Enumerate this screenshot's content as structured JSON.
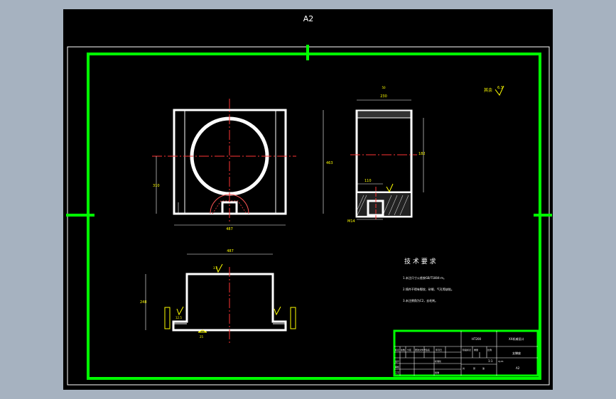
{
  "sheet": {
    "size_label": "A2",
    "roughness_note": "其余",
    "roughness_value": "6.3"
  },
  "dims": {
    "front_width": "487",
    "front_height": "463",
    "front_left": "310",
    "side_width": "230",
    "side_height": "182",
    "side_small": "110",
    "side_top": "50",
    "side_bottom": "M14",
    "plan_width": "487",
    "plan_height": "248",
    "rough_a": "12.5",
    "rough_b": "3.2",
    "rough_c": "25"
  },
  "tech": {
    "title": "技 术 要 求",
    "items": [
      "1.未注尺寸公差按GB/T1804-m。",
      "2.铸件不得有裂纹、砂眼、气孔等缺陷。",
      "3.未注倒角为C2，去毛刺。"
    ]
  },
  "title_block": {
    "part_name": "支撑座",
    "org": "XX机械设计",
    "drawing_no": "XJ-01",
    "material": "HT200",
    "scale": "1:1",
    "sheet": "A2",
    "labels": [
      "标记",
      "处数",
      "分区",
      "更改文件号",
      "签名",
      "年月日",
      "设计",
      "标准化",
      "审核",
      "工艺",
      "批准",
      "阶段标记",
      "重量",
      "比例",
      "共",
      "张",
      "第"
    ]
  }
}
